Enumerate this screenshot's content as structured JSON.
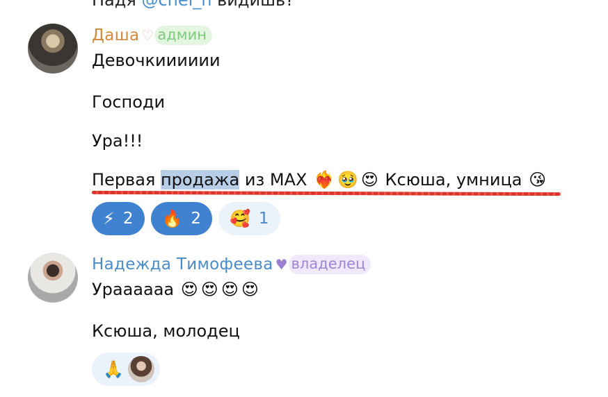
{
  "previous_message": {
    "prefix": "Надя",
    "mention": "@chel_n",
    "suffix": "видишь?"
  },
  "messages": [
    {
      "author": "Даша",
      "author_color": "#d38a3a",
      "heart_icon": "pink-heart",
      "role": "админ",
      "lines": [
        "Девочкииииии",
        "Господи",
        "Ура!!!"
      ],
      "last_line": {
        "before_highlight": "Первая ",
        "highlight": "продажа",
        "after_highlight": " из MAX",
        "emoji_1": "❤️‍🔥",
        "emoji_2": "🥹",
        "emoji_3": "😍",
        "tail": " Ксюша, умница ",
        "emoji_4": "😘"
      },
      "reactions": [
        {
          "emoji": "⚡",
          "count": "2",
          "selected": true
        },
        {
          "emoji": "🔥",
          "count": "2",
          "selected": true
        },
        {
          "emoji": "🥰",
          "count": "1",
          "selected": false
        }
      ]
    },
    {
      "author": "Надежда Тимофеева",
      "author_color": "#4a8bc9",
      "heart_icon": "purple-heart",
      "role": "владелец",
      "line_1": "Ураааааа",
      "line_1_emojis": [
        "😍",
        "😍",
        "😍",
        "😍"
      ],
      "line_2": "Ксюша, молодец",
      "reaction": {
        "emoji": "🙏"
      }
    }
  ]
}
